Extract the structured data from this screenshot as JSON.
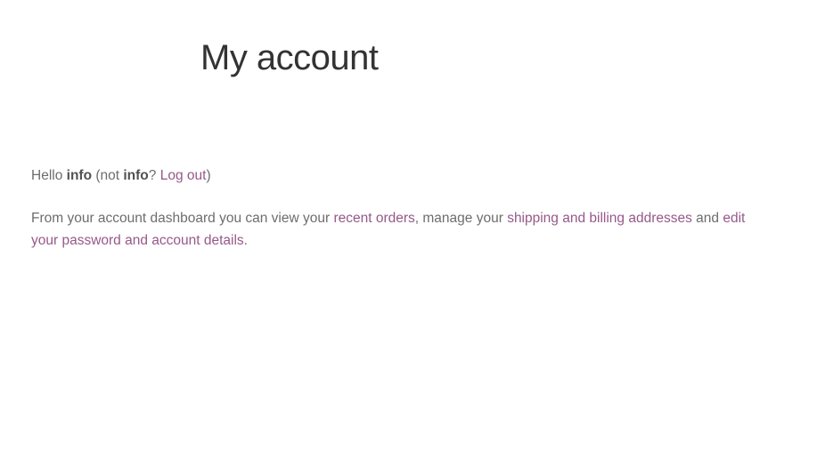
{
  "page": {
    "title": "My account"
  },
  "greeting": {
    "hello": "Hello ",
    "username": "info",
    "not_open": " (not ",
    "username_again": "info",
    "question": "? ",
    "logout_link": "Log out",
    "close_paren": ")"
  },
  "dashboard": {
    "intro": "From your account dashboard you can view your ",
    "recent_orders_link": "recent orders",
    "manage": ", manage your ",
    "addresses_link": "shipping and billing addresses",
    "and": " and ",
    "account_details_link": "edit your password and account details",
    "end": "."
  },
  "colors": {
    "link": "#96588a",
    "text": "#6d6d6d",
    "title": "#333333"
  }
}
